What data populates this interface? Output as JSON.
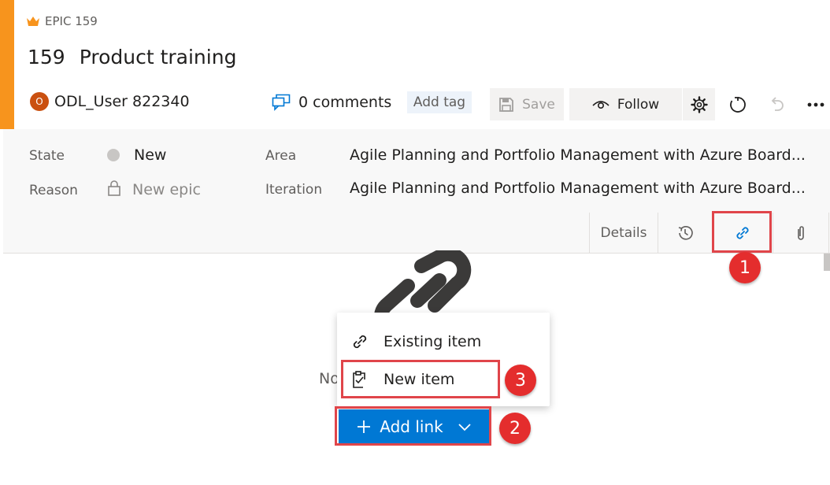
{
  "header": {
    "type_label": "EPIC 159",
    "id": "159",
    "title": "Product training",
    "assigned_user": "ODL_User 822340",
    "avatar_initial": "O",
    "comments": "0 comments",
    "add_tag": "Add tag",
    "save_label": "Save",
    "follow_label": "Follow"
  },
  "fields": {
    "state_label": "State",
    "state_value": "New",
    "reason_label": "Reason",
    "reason_value": "New epic",
    "area_label": "Area",
    "area_value": "Agile Planning and Portfolio Management with Azure Board...",
    "iteration_label": "Iteration",
    "iteration_value": "Agile Planning and Portfolio Management with Azure Board..."
  },
  "tabs": {
    "details": "Details"
  },
  "links_panel": {
    "empty_text_partial": "No",
    "add_link_label": "Add link",
    "menu": [
      {
        "label": "Existing item",
        "icon": "link-icon"
      },
      {
        "label": "New item",
        "icon": "new-work-item-icon"
      }
    ]
  },
  "annotations": [
    "1",
    "2",
    "3"
  ],
  "colors": {
    "accent": "#f7941d",
    "primary": "#0078d4",
    "highlight": "#e0454a",
    "badge": "#e42d2d"
  }
}
